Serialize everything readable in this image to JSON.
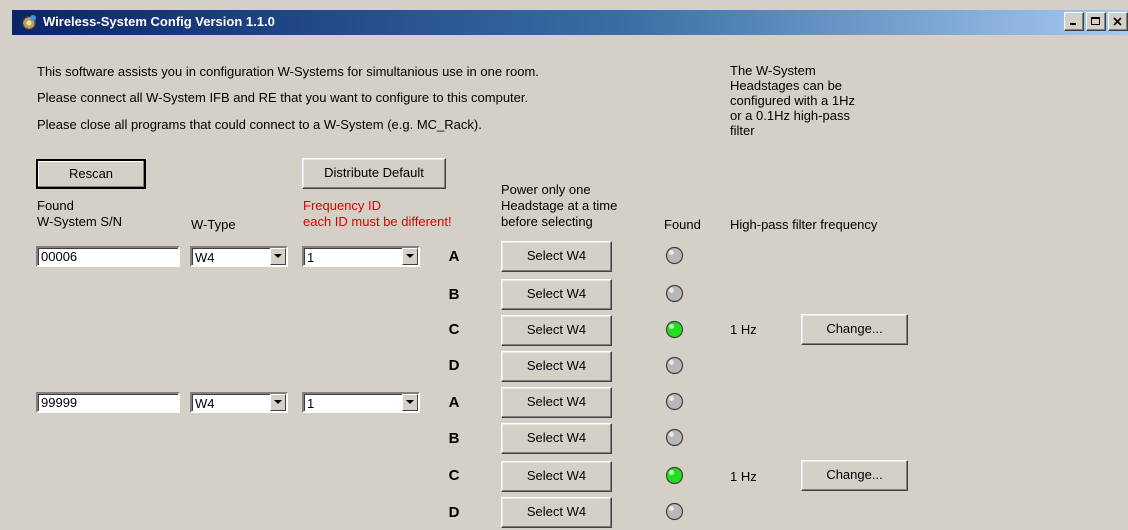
{
  "window": {
    "title": "Wireless-System Config Version 1.1.0"
  },
  "intro": [
    "This software assists you in configuration W-Systems for simultanious use in one room.",
    "Please connect all W-System IFB and RE that you want to configure to this computer.",
    "Please close all programs that could connect to a W-System (e.g. MC_Rack)."
  ],
  "side_note": [
    "The W-System",
    "Headstages can be",
    "configured with a 1Hz",
    "or a 0.1Hz high-pass",
    "filter"
  ],
  "buttons": {
    "rescan": "Rescan",
    "distribute": "Distribute Default"
  },
  "headers": {
    "found_line1": "Found",
    "found_line2": "W-System S/N",
    "wtype": "W-Type",
    "freq_line1": "Frequency ID",
    "freq_line2": "each ID must be different!",
    "power_line1": "Power only one",
    "power_line2": "Headstage at a time",
    "power_line3": "before selecting",
    "found_col": "Found",
    "hpf": "High-pass filter frequency"
  },
  "colors": {
    "red_text": "#e00000",
    "led_on": "#22dd22",
    "led_off": "#b8b8b8"
  },
  "systems": [
    {
      "serial": "00006",
      "wtype": "W4",
      "freq_id": "1",
      "headstages": [
        {
          "letter": "A",
          "select": "Select W4",
          "found": false
        },
        {
          "letter": "B",
          "select": "Select W4",
          "found": false
        },
        {
          "letter": "C",
          "select": "Select W4",
          "found": true,
          "hpf": "1 Hz",
          "change": "Change..."
        },
        {
          "letter": "D",
          "select": "Select W4",
          "found": false
        }
      ]
    },
    {
      "serial": "99999",
      "wtype": "W4",
      "freq_id": "1",
      "headstages": [
        {
          "letter": "A",
          "select": "Select W4",
          "found": false
        },
        {
          "letter": "B",
          "select": "Select W4",
          "found": false
        },
        {
          "letter": "C",
          "select": "Select W4",
          "found": true,
          "hpf": "1 Hz",
          "change": "Change..."
        },
        {
          "letter": "D",
          "select": "Select W4",
          "found": false
        }
      ]
    }
  ]
}
